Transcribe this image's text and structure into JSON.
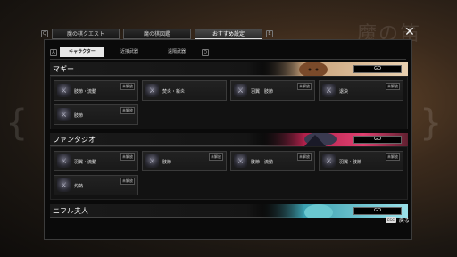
{
  "tabs": [
    {
      "label": "魔の棋クエスト",
      "active": false
    },
    {
      "label": "魔の棋図鑑",
      "active": false
    },
    {
      "label": "おすすめ設定",
      "active": true
    }
  ],
  "tab_keys": {
    "left": "Q",
    "right": "E"
  },
  "subtab_keys": {
    "left": "A",
    "right": "D"
  },
  "subtabs": [
    {
      "label": "キャラクター",
      "active": true
    },
    {
      "label": "近接武器",
      "active": false
    },
    {
      "label": "遠隔武器",
      "active": false
    }
  ],
  "background": {
    "watermark": "魔の笛"
  },
  "sections": [
    {
      "name": "マギー",
      "go_label": "GO",
      "accent": "#d8b48a",
      "cards": [
        {
          "icon": "weapon-icon",
          "label": "肢節・流動",
          "status": "未解放"
        },
        {
          "icon": "weapon-icon",
          "label": "焚炎・新炎",
          "status": ""
        },
        {
          "icon": "weapon-icon",
          "label": "羽翼・肢節",
          "status": "未解放"
        },
        {
          "icon": "weapon-icon",
          "label": "退決",
          "status": "未解放"
        },
        {
          "icon": "weapon-icon",
          "label": "肢節",
          "status": "未解放"
        }
      ]
    },
    {
      "name": "ファンタジオ",
      "go_label": "GO",
      "accent": "#c0305a",
      "cards": [
        {
          "icon": "weapon-icon",
          "label": "羽翼・流動",
          "status": "未解放"
        },
        {
          "icon": "weapon-icon",
          "label": "肢節",
          "status": "未解放"
        },
        {
          "icon": "weapon-icon",
          "label": "肢節・流動",
          "status": "未解放"
        },
        {
          "icon": "weapon-icon",
          "label": "羽翼・肢節",
          "status": "未解放"
        },
        {
          "icon": "weapon-icon",
          "label": "灼熱",
          "status": "未解放"
        }
      ]
    },
    {
      "name": "ニフル夫人",
      "go_label": "GO",
      "accent": "#5ab8c8",
      "cards": []
    }
  ],
  "footer": {
    "key": "ESC",
    "label": "戻る"
  }
}
